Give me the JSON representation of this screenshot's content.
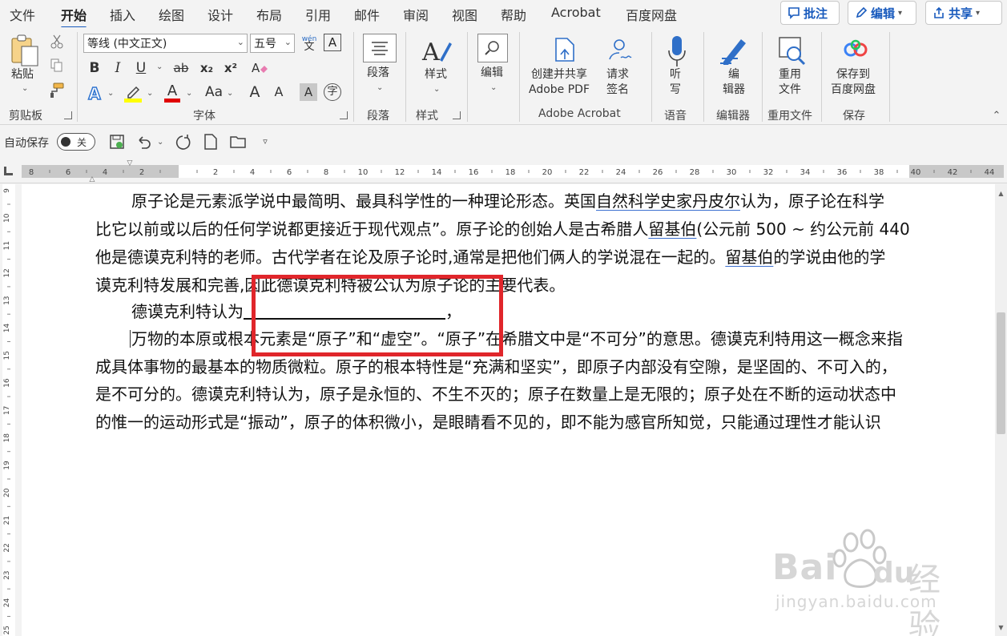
{
  "menubar": {
    "tabs": [
      "文件",
      "开始",
      "插入",
      "绘图",
      "设计",
      "布局",
      "引用",
      "邮件",
      "审阅",
      "视图",
      "帮助",
      "Acrobat",
      "百度网盘"
    ],
    "active_tab": "开始",
    "comment_btn": "批注",
    "edit_btn": "编辑",
    "share_btn": "共享"
  },
  "ribbon": {
    "clipboard": {
      "paste": "粘贴",
      "label": "剪贴板"
    },
    "font": {
      "font_name": "等线 (中文正文)",
      "font_size": "五号",
      "label": "字体",
      "bold": "B",
      "italic": "I",
      "underline": "U",
      "strike": "ab",
      "sub": "x₂",
      "sup": "x²",
      "grow": "A",
      "shrink": "A",
      "case": "Aa",
      "shade": "A",
      "enclose": "字",
      "wen": "wén\n文"
    },
    "paragraph": {
      "label": "段落"
    },
    "styles": {
      "btn": "样式",
      "label": "样式"
    },
    "editing": {
      "btn": "编辑"
    },
    "acrobat": {
      "create_pdf": "创建并共享\nAdobe PDF",
      "sign": "请求\n签名",
      "label": "Adobe Acrobat"
    },
    "voice": {
      "dictate": "听\n写",
      "label": "语音"
    },
    "editor": {
      "btn": "编\n辑器",
      "label": "编辑器"
    },
    "reuse": {
      "btn": "重用\n文件",
      "label": "重用文件"
    },
    "save": {
      "btn": "保存到\n百度网盘",
      "label": "保存"
    }
  },
  "qat": {
    "autosave": "自动保存",
    "toggle": "关"
  },
  "ruler": {
    "labels_left": [
      "8",
      "6",
      "4",
      "2"
    ],
    "labels_right": [
      "2",
      "4",
      "6",
      "8",
      "10",
      "12",
      "14",
      "16",
      "18",
      "20",
      "22",
      "24",
      "26",
      "28",
      "30",
      "32",
      "34",
      "36",
      "38",
      "40",
      "42",
      "44"
    ],
    "vertical_labels": [
      "9",
      "10",
      "11",
      "12",
      "13",
      "14",
      "15",
      "16",
      "17",
      "18",
      "19",
      "20",
      "21",
      "22",
      "23",
      "24",
      "25"
    ]
  },
  "document": {
    "p1_line1_a": "原子论是元素派学说中最简明、最具科学性的一种理论形态。英国",
    "p1_line1_link": "自然科学史家丹皮尔",
    "p1_line1_b": "认为，原子论在科学",
    "p1_line2_a": "比它以前或以后的任何学说都更接近于现代观点”。原子论的创始人是古希腊人",
    "p1_line2_link": "留基伯",
    "p1_line2_b": "(公元前 500 ~ 约公元前 440",
    "p1_line3_a": "他是德谟克利特的老师。古代学者在论及原子论时,通常是把他们俩人的学说混在一起的。",
    "p1_line3_link": "留基伯",
    "p1_line3_b": "的学说由他的学",
    "p1_line4": "谟克利特发展和完善,因此德谟克利特被公认为原子论的主要代表。",
    "p2_prefix": "德谟克利特认为",
    "p2_suffix": "，",
    "p3_line1": "万物的本原或根本元素是“原子”和“虚空”。“原子”在希腊文中是“不可分”的意思。德谟克利特用这一概念来指",
    "p3_line2": "成具体事物的最基本的物质微粒。原子的根本特性是“充满和坚实”，即原子内部没有空隙，是坚固的、不可入的，",
    "p3_line3": "是不可分的。德谟克利特认为，原子是永恒的、不生不灭的；原子在数量上是无限的；原子处在不断的运动状态中",
    "p3_line4": "的惟一的运动形式是“振动”，原子的体积微小，是眼睛看不见的，即不能为感官所知觉，只能通过理性才能认识"
  },
  "watermark": {
    "brand": "Bai",
    "brand2": "du",
    "jingyan": "经验",
    "url": "jingyan.baidu.com"
  },
  "colors": {
    "accent": "#185abd",
    "highlight_box": "#e0262b",
    "link_underline": "#3b6fd0"
  }
}
